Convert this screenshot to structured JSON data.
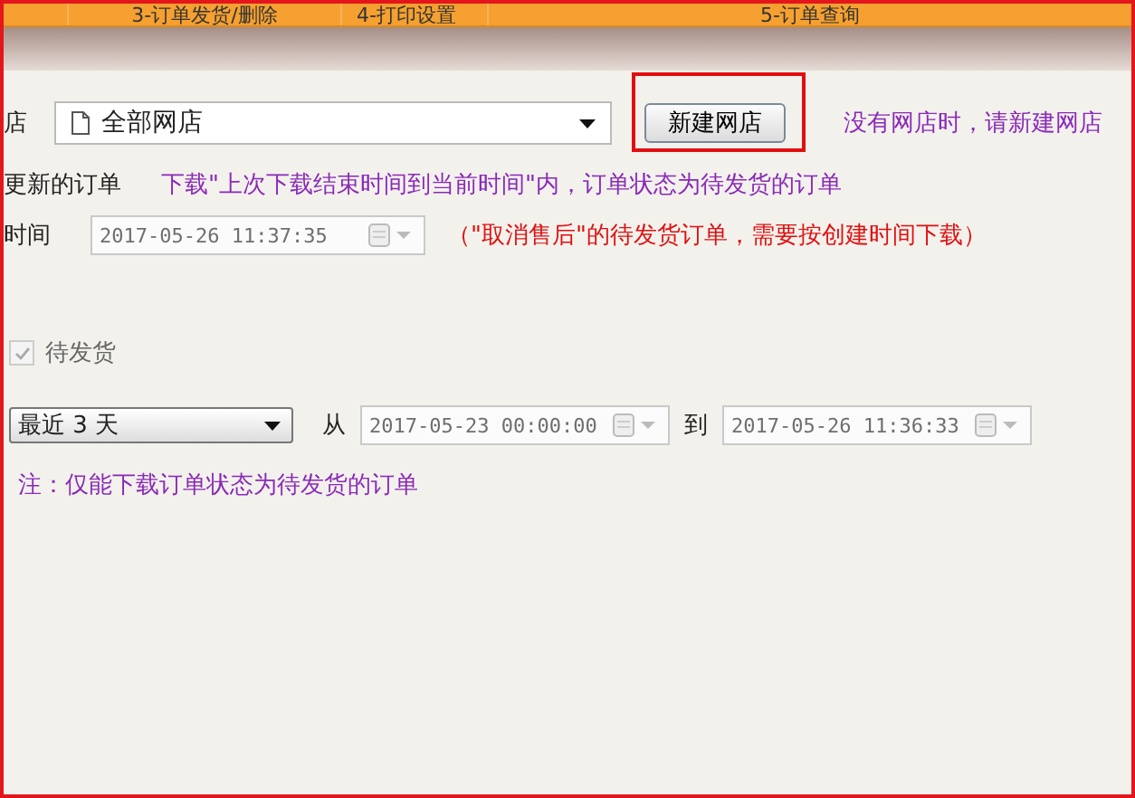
{
  "tabs": [
    {
      "label": "3-订单发货/删除",
      "selected": false
    },
    {
      "label": "4-打印设置",
      "selected": false
    },
    {
      "label": "5-订单查询",
      "selected": false
    }
  ],
  "store_row": {
    "label": "店",
    "select": {
      "value": "全部网店"
    },
    "button": {
      "label": "新建网店",
      "highlighted": true
    },
    "hint": "没有网店时，请新建网店"
  },
  "update_row": {
    "label": "更新的订单",
    "note": "下载\"上次下载结束时间到当前时间\"内，订单状态为待发货的订单"
  },
  "time_row": {
    "label": "时间",
    "field": {
      "value": "2017-05-26 11:37:35",
      "disabled": true
    },
    "note": "（\"取消售后\"的待发货订单，需要按创建时间下载）"
  },
  "status": {
    "label": "待发货",
    "checked": true,
    "disabled": true
  },
  "range": {
    "preset": "最近 3 天",
    "from_label": "从",
    "from": {
      "value": "2017-05-23 00:00:00",
      "disabled": true
    },
    "to_label": "到",
    "to": {
      "value": "2017-05-26 11:36:33",
      "disabled": true
    }
  },
  "footnote": "注：仅能下载订单状态为待发货的订单"
}
